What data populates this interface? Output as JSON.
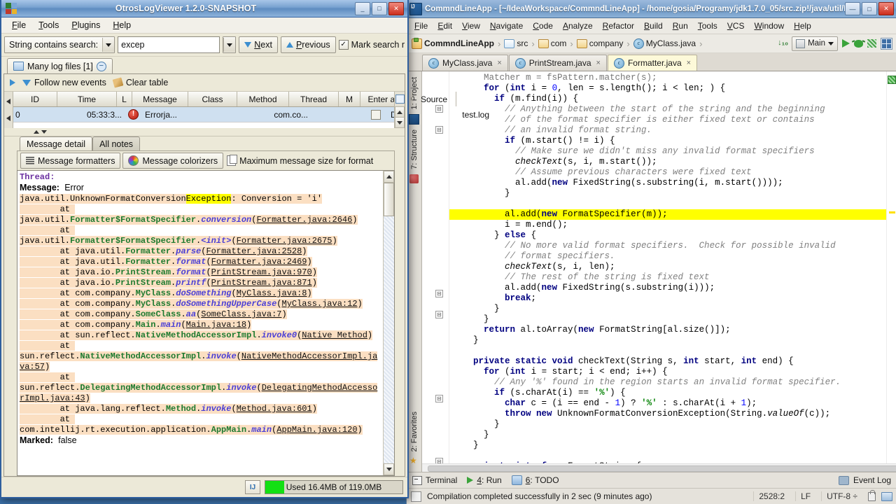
{
  "ide": {
    "title": "CommndLineApp - [~/IdeaWorkspace/CommndLineApp] - /home/gosia/Programy/jdk1.7.0_05/src.zip!/java/util/F",
    "window_buttons": {
      "minimize": "—",
      "maximize": "□",
      "close": "✕"
    },
    "menu": [
      "File",
      "Edit",
      "View",
      "Navigate",
      "Code",
      "Analyze",
      "Refactor",
      "Build",
      "Run",
      "Tools",
      "VCS",
      "Window",
      "Help"
    ],
    "breadcrumb": [
      {
        "label": "CommndLineApp",
        "icon": "module-icon",
        "bold": true
      },
      {
        "label": "src",
        "icon": "folder-icon"
      },
      {
        "label": "com",
        "icon": "package-icon"
      },
      {
        "label": "company",
        "icon": "package-icon"
      },
      {
        "label": "MyClass.java",
        "icon": "class-icon"
      }
    ],
    "run_config": "Main",
    "toolbar_icons": [
      "sort-icon",
      "run-icon",
      "debug-icon",
      "coverage-icon",
      "project-structure-icon"
    ],
    "editor_tabs": [
      {
        "label": "MyClass.java",
        "icon": "class-icon",
        "active": false
      },
      {
        "label": "PrintStream.java",
        "icon": "class-readonly-icon",
        "active": false
      },
      {
        "label": "Formatter.java",
        "icon": "class-readonly-icon",
        "active": true
      }
    ],
    "left_toolwindows": [
      "1: Project",
      "7: Structure",
      "2: Favorites"
    ],
    "tool_windows": [
      {
        "label": "Terminal",
        "icon": "terminal-icon",
        "mnemonic": ""
      },
      {
        "label": "Run",
        "icon": "run-icon",
        "mnemonic": "4"
      },
      {
        "label": "TODO",
        "icon": "todo-icon",
        "mnemonic": "6"
      }
    ],
    "event_log": "Event Log",
    "status": {
      "message": "Compilation completed successfully in 2 sec (9 minutes ago)",
      "caret": "2528:2",
      "line_separator": "LF",
      "encoding": "UTF-8 ÷",
      "lock_icon": "lock-icon",
      "print_icon": "print-icon"
    },
    "code_lines": [
      {
        "indent": 6,
        "clipped": true,
        "tokens": [
          {
            "t": "Matcher m = fsPattern.matcher(s);",
            "c": "pln"
          }
        ]
      },
      {
        "indent": 6,
        "tokens": [
          {
            "t": "for ",
            "c": "kw"
          },
          {
            "t": "(",
            "c": "pln"
          },
          {
            "t": "int",
            "c": "kw"
          },
          {
            "t": " i = ",
            "c": "pln"
          },
          {
            "t": "0",
            "c": "num"
          },
          {
            "t": ", len = s.length(); i < len; ) {",
            "c": "pln"
          }
        ]
      },
      {
        "indent": 8,
        "tokens": [
          {
            "t": "if ",
            "c": "kw"
          },
          {
            "t": "(m.find(i)) {",
            "c": "pln"
          }
        ]
      },
      {
        "indent": 10,
        "tokens": [
          {
            "t": "// Anything between the start of the string and the beginning",
            "c": "cm"
          }
        ]
      },
      {
        "indent": 10,
        "tokens": [
          {
            "t": "// of the format specifier is either fixed text or contains",
            "c": "cm"
          }
        ]
      },
      {
        "indent": 10,
        "tokens": [
          {
            "t": "// an invalid format string.",
            "c": "cm"
          }
        ]
      },
      {
        "indent": 10,
        "tokens": [
          {
            "t": "if ",
            "c": "kw"
          },
          {
            "t": "(m.start() != i) {",
            "c": "pln"
          }
        ]
      },
      {
        "indent": 12,
        "tokens": [
          {
            "t": "// Make sure we didn't miss any invalid format specifiers",
            "c": "cm"
          }
        ]
      },
      {
        "indent": 12,
        "tokens": [
          {
            "t": "checkText",
            "c": "mth"
          },
          {
            "t": "(s, i, m.start());",
            "c": "pln"
          }
        ]
      },
      {
        "indent": 12,
        "tokens": [
          {
            "t": "// Assume previous characters were fixed text",
            "c": "cm"
          }
        ]
      },
      {
        "indent": 12,
        "tokens": [
          {
            "t": "al.add(",
            "c": "pln"
          },
          {
            "t": "new ",
            "c": "kw"
          },
          {
            "t": "FixedString(s.substring(i, m.start())));",
            "c": "pln"
          }
        ]
      },
      {
        "indent": 10,
        "tokens": [
          {
            "t": "}",
            "c": "pln"
          }
        ]
      },
      {
        "indent": 0,
        "tokens": [
          {
            "t": "",
            "c": "pln"
          }
        ]
      },
      {
        "indent": 10,
        "highlight": true,
        "tokens": [
          {
            "t": "al.add(",
            "c": "pln"
          },
          {
            "t": "new ",
            "c": "kw"
          },
          {
            "t": "FormatSpecifier(m));",
            "c": "pln"
          }
        ]
      },
      {
        "indent": 10,
        "tokens": [
          {
            "t": "i = m.end();",
            "c": "pln"
          }
        ]
      },
      {
        "indent": 8,
        "tokens": [
          {
            "t": "} ",
            "c": "pln"
          },
          {
            "t": "else",
            "c": "kw"
          },
          {
            "t": " {",
            "c": "pln"
          }
        ]
      },
      {
        "indent": 10,
        "tokens": [
          {
            "t": "// No more valid format specifiers.  Check for possible invalid",
            "c": "cm"
          }
        ]
      },
      {
        "indent": 10,
        "tokens": [
          {
            "t": "// format specifiers.",
            "c": "cm"
          }
        ]
      },
      {
        "indent": 10,
        "tokens": [
          {
            "t": "checkText",
            "c": "mth"
          },
          {
            "t": "(s, i, len);",
            "c": "pln"
          }
        ]
      },
      {
        "indent": 10,
        "tokens": [
          {
            "t": "// The rest of the string is fixed text",
            "c": "cm"
          }
        ]
      },
      {
        "indent": 10,
        "tokens": [
          {
            "t": "al.add(",
            "c": "pln"
          },
          {
            "t": "new ",
            "c": "kw"
          },
          {
            "t": "FixedString(s.substring(i)));",
            "c": "pln"
          }
        ]
      },
      {
        "indent": 10,
        "tokens": [
          {
            "t": "break",
            "c": "kw"
          },
          {
            "t": ";",
            "c": "pln"
          }
        ]
      },
      {
        "indent": 8,
        "tokens": [
          {
            "t": "}",
            "c": "pln"
          }
        ]
      },
      {
        "indent": 6,
        "tokens": [
          {
            "t": "}",
            "c": "pln"
          }
        ]
      },
      {
        "indent": 6,
        "tokens": [
          {
            "t": "return ",
            "c": "kw"
          },
          {
            "t": "al.toArray(",
            "c": "pln"
          },
          {
            "t": "new ",
            "c": "kw"
          },
          {
            "t": "FormatString[al.size()]);",
            "c": "pln"
          }
        ]
      },
      {
        "indent": 4,
        "tokens": [
          {
            "t": "}",
            "c": "pln"
          }
        ]
      },
      {
        "indent": 0,
        "tokens": [
          {
            "t": "",
            "c": "pln"
          }
        ]
      },
      {
        "indent": 4,
        "tokens": [
          {
            "t": "private static void ",
            "c": "kw"
          },
          {
            "t": "checkText(String s, ",
            "c": "pln"
          },
          {
            "t": "int",
            "c": "kw"
          },
          {
            "t": " start, ",
            "c": "pln"
          },
          {
            "t": "int",
            "c": "kw"
          },
          {
            "t": " end) {",
            "c": "pln"
          }
        ]
      },
      {
        "indent": 6,
        "tokens": [
          {
            "t": "for ",
            "c": "kw"
          },
          {
            "t": "(",
            "c": "pln"
          },
          {
            "t": "int",
            "c": "kw"
          },
          {
            "t": " i = start; i < end; i++) {",
            "c": "pln"
          }
        ]
      },
      {
        "indent": 8,
        "tokens": [
          {
            "t": "// Any '%' found in the region starts an invalid format specifier.",
            "c": "cm"
          }
        ]
      },
      {
        "indent": 8,
        "tokens": [
          {
            "t": "if ",
            "c": "kw"
          },
          {
            "t": "(s.charAt(i) == ",
            "c": "pln"
          },
          {
            "t": "'%'",
            "c": "str"
          },
          {
            "t": ") {",
            "c": "pln"
          }
        ]
      },
      {
        "indent": 10,
        "tokens": [
          {
            "t": "char ",
            "c": "kw"
          },
          {
            "t": "c = (i == end - ",
            "c": "pln"
          },
          {
            "t": "1",
            "c": "num"
          },
          {
            "t": ") ? ",
            "c": "pln"
          },
          {
            "t": "'%'",
            "c": "str"
          },
          {
            "t": " : s.charAt(i + ",
            "c": "pln"
          },
          {
            "t": "1",
            "c": "num"
          },
          {
            "t": ");",
            "c": "pln"
          }
        ]
      },
      {
        "indent": 10,
        "tokens": [
          {
            "t": "throw new ",
            "c": "kw"
          },
          {
            "t": "UnknownFormatConversionException(String.",
            "c": "pln"
          },
          {
            "t": "valueOf",
            "c": "mth"
          },
          {
            "t": "(c));",
            "c": "pln"
          }
        ]
      },
      {
        "indent": 8,
        "tokens": [
          {
            "t": "}",
            "c": "pln"
          }
        ]
      },
      {
        "indent": 6,
        "tokens": [
          {
            "t": "}",
            "c": "pln"
          }
        ]
      },
      {
        "indent": 4,
        "tokens": [
          {
            "t": "}",
            "c": "pln"
          }
        ]
      },
      {
        "indent": 0,
        "tokens": [
          {
            "t": "",
            "c": "pln"
          }
        ]
      },
      {
        "indent": 4,
        "tokens": [
          {
            "t": "private interface ",
            "c": "kw"
          },
          {
            "t": "FormatString {",
            "c": "pln"
          }
        ]
      }
    ]
  },
  "olv": {
    "title": "OtrosLogViewer 1.2.0-SNAPSHOT",
    "window_buttons": {
      "minimize": "_",
      "maximize": "□",
      "close": "✕"
    },
    "menu": [
      "File",
      "Tools",
      "Plugins",
      "Help"
    ],
    "search": {
      "mode_label": "String contains search:",
      "query": "excep",
      "placeholder": "",
      "next_label": "Next",
      "previous_label": "Previous",
      "mark_label": "Mark search r",
      "mark_checked": true
    },
    "log_tab": {
      "label": "Many log files [1]",
      "icon": "logs-icon",
      "close_icon": "minus-icon"
    },
    "events_toolbar": {
      "play_icon": "play-icon",
      "follow_label": "Follow new events",
      "clear_label": "Clear table"
    },
    "table": {
      "columns": [
        "ID",
        "Time",
        "L",
        "Message",
        "Class",
        "Method",
        "Thread",
        "M",
        "Enter a ...",
        "Source"
      ],
      "rows": [
        {
          "ID": "0",
          "Time": "05:33:3...",
          "L": "error-icon",
          "Message": "Errorja...",
          "Class": "",
          "Method": "com.co...",
          "Thread": "",
          "M": "checkbox",
          "Enter a ...": "D",
          "Source": "test.log"
        }
      ]
    },
    "detail_tabs": [
      {
        "label": "Message detail",
        "active": true
      },
      {
        "label": "All notes",
        "active": false
      }
    ],
    "detail_toolbar": {
      "formatters_label": "Message formatters",
      "colorizers_label": "Message colorizers",
      "max_size_label": "Maximum message size for format"
    },
    "detail": {
      "thread_label": "Thread:",
      "message_label": "Message:",
      "message_value": "Error",
      "exception_head_pre": "java.util.UnknownFormatConversion",
      "exception_head_hl": "Exception",
      "exception_head_post": ": Conversion = 'i'",
      "stack": [
        {
          "pkg": "java.util.",
          "cls": "Formatter$FormatSpecifier",
          "mth": "conversion",
          "loc": "Formatter.java:2646",
          "wrap": true
        },
        {
          "pkg": "java.util.",
          "cls": "Formatter$FormatSpecifier",
          "mth": "<init>",
          "loc": "Formatter.java:2675",
          "wrap": true
        },
        {
          "pkg": "java.util.",
          "cls": "Formatter",
          "mth": "parse",
          "loc": "Formatter.java:2528",
          "wrap": false
        },
        {
          "pkg": "java.util.",
          "cls": "Formatter",
          "mth": "format",
          "loc": "Formatter.java:2469",
          "wrap": false
        },
        {
          "pkg": "java.io.",
          "cls": "PrintStream",
          "mth": "format",
          "loc": "PrintStream.java:970",
          "wrap": false
        },
        {
          "pkg": "java.io.",
          "cls": "PrintStream",
          "mth": "printf",
          "loc": "PrintStream.java:871",
          "wrap": false
        },
        {
          "pkg": "com.company.",
          "cls": "MyClass",
          "mth": "doSomething",
          "loc": "MyClass.java:8",
          "wrap": false
        },
        {
          "pkg": "com.company.",
          "cls": "MyClass",
          "mth": "doSomethingUpperCase",
          "loc": "MyClass.java:12",
          "wrap": false
        },
        {
          "pkg": "com.company.",
          "cls": "SomeClass",
          "mth": "aa",
          "loc": "SomeClass.java:7",
          "wrap": false
        },
        {
          "pkg": "com.company.",
          "cls": "Main",
          "mth": "main",
          "loc": "Main.java:18",
          "wrap": false
        },
        {
          "pkg": "sun.reflect.",
          "cls": "NativeMethodAccessorImpl",
          "mth": "invoke0",
          "loc": "Native Method",
          "wrap": false
        },
        {
          "pkg": "sun.reflect.",
          "cls": "NativeMethodAccessorImpl",
          "mth": "invoke",
          "loc": "NativeMethodAccessorImpl.java:57",
          "wrap": true
        },
        {
          "pkg": "sun.reflect.",
          "cls": "DelegatingMethodAccessorImpl",
          "mth": "invoke",
          "loc": "DelegatingMethodAccessorImpl.java:43",
          "wrap": true
        },
        {
          "pkg": "java.lang.reflect.",
          "cls": "Method",
          "mth": "invoke",
          "loc": "Method.java:601",
          "wrap": false
        },
        {
          "pkg": "com.intellij.rt.execution.application.",
          "cls": "AppMain",
          "mth": "main",
          "loc": "AppMain.java:120",
          "wrap": true
        }
      ],
      "at_label": "at",
      "marked_label": "Marked:",
      "marked_value": "false"
    },
    "statusbar": {
      "memory": "Used 16.4MB of 119.0MB",
      "memory_percent": 14,
      "ij_badge": "IJ"
    }
  }
}
